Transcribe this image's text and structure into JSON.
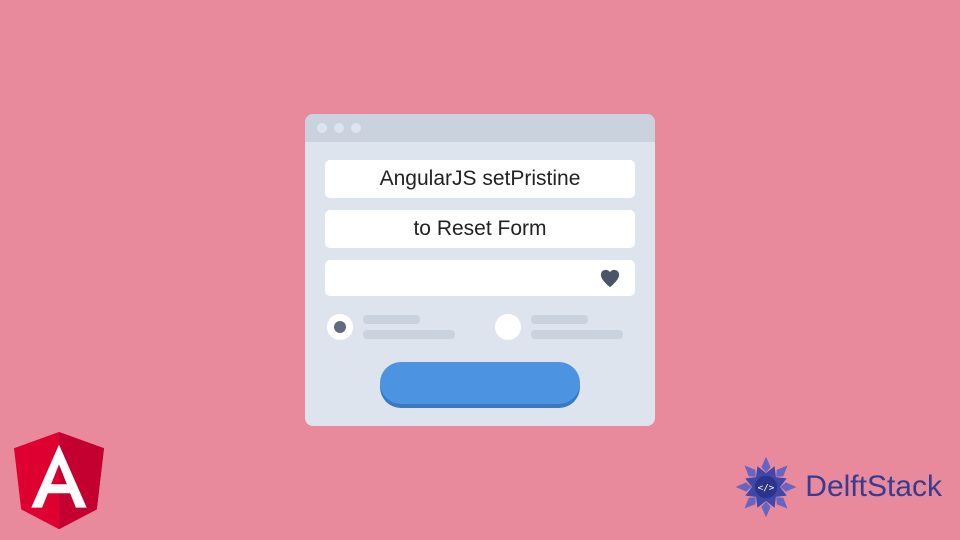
{
  "window": {
    "line1": "AngularJS setPristine",
    "line2": "to Reset Form"
  },
  "icons": {
    "heart": "heart-icon",
    "angular": "angular-logo",
    "mandala": "delftstack-emblem"
  },
  "brand": {
    "name": "DelftStack"
  },
  "colors": {
    "bg": "#e8899c",
    "window": "#dde4ed",
    "titlebar": "#c9d2dd",
    "button": "#4c94e1",
    "button_shadow": "#3a78c0",
    "heart": "#4a5568",
    "angular_red": "#dd0031",
    "angular_dark": "#c3002f",
    "brand_text": "#373c91"
  }
}
